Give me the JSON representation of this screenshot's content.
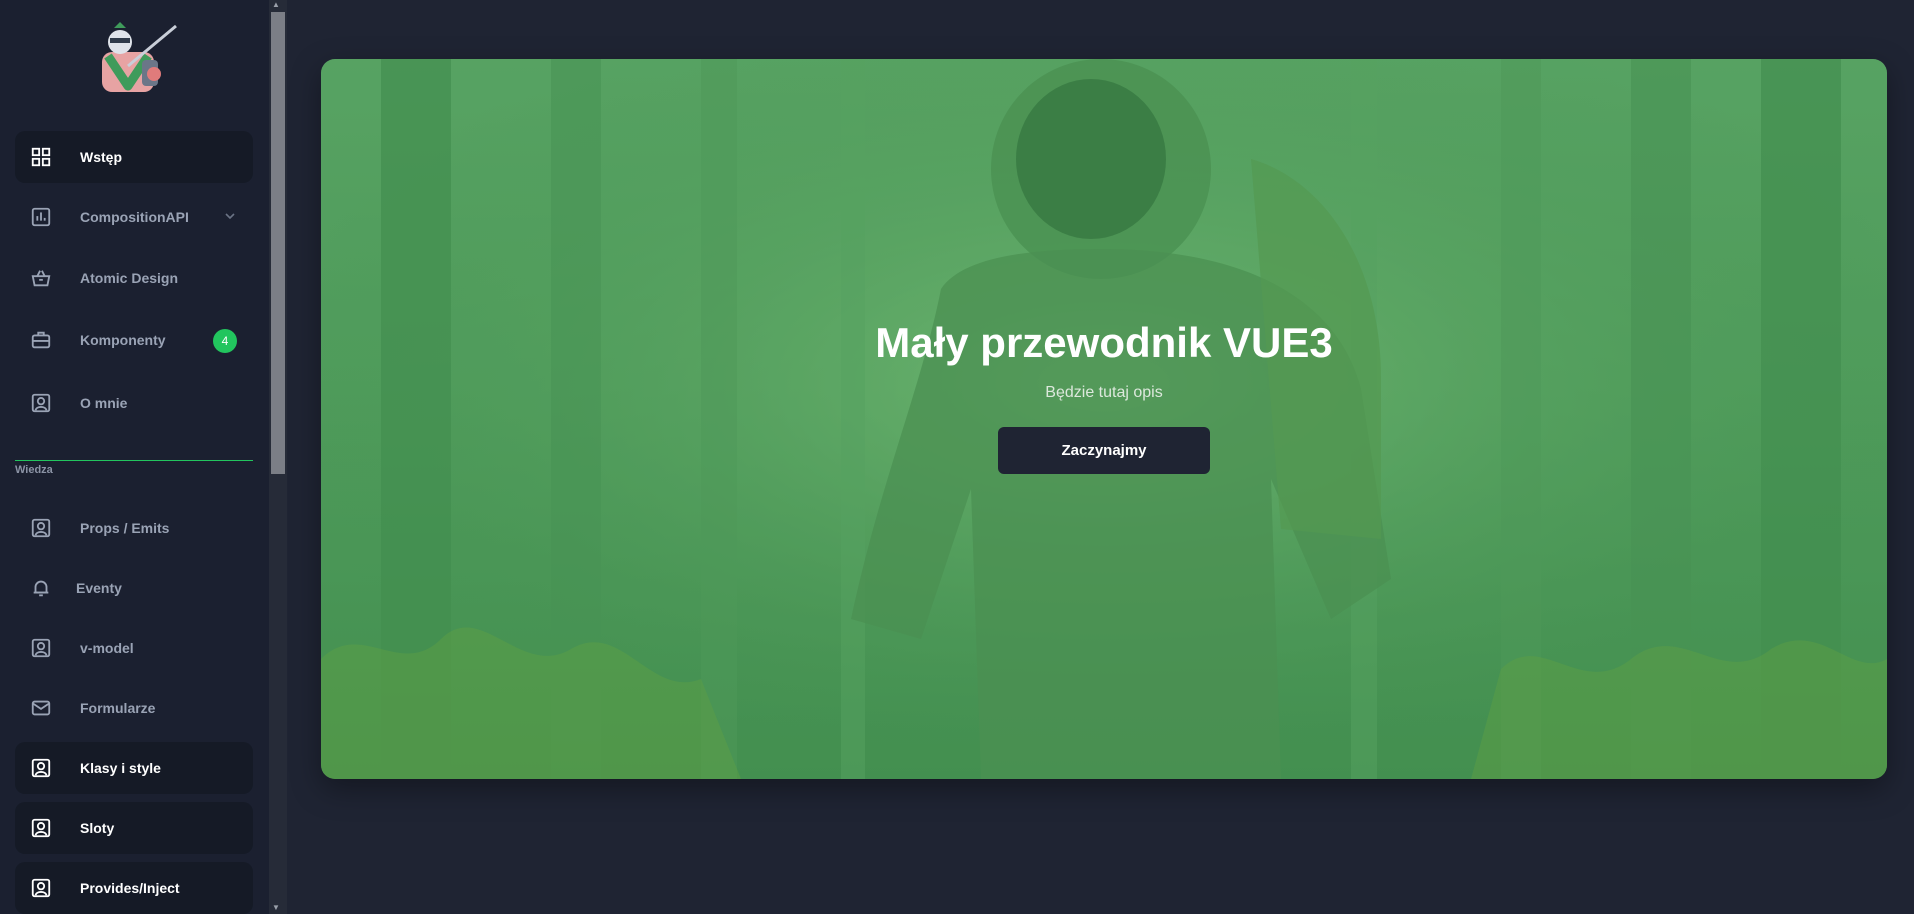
{
  "sidebar": {
    "logo_icon": "knight-vue-logo",
    "items": [
      {
        "label": "Wstęp",
        "icon": "grid-icon",
        "active": true
      },
      {
        "label": "CompositionAPI",
        "icon": "bar-chart-icon",
        "expandable": true
      },
      {
        "label": "Atomic Design",
        "icon": "basket-icon"
      },
      {
        "label": "Komponenty",
        "icon": "briefcase-icon",
        "badge": "4"
      },
      {
        "label": "O mnie",
        "icon": "user-square-icon"
      }
    ],
    "section_label": "Wiedza",
    "knowledge_items": [
      {
        "label": "Props / Emits",
        "icon": "user-square-icon"
      },
      {
        "label": "Eventy",
        "icon": "bell-icon"
      },
      {
        "label": "v-model",
        "icon": "user-square-icon"
      },
      {
        "label": "Formularze",
        "icon": "mail-icon"
      },
      {
        "label": "Klasy i style",
        "icon": "user-square-icon",
        "active": true
      },
      {
        "label": "Sloty",
        "icon": "user-square-icon",
        "active": true
      },
      {
        "label": "Provides/Inject",
        "icon": "user-square-icon",
        "active": true
      }
    ]
  },
  "hero": {
    "title": "Mały przewodnik VUE3",
    "subtitle": "Będzie tutaj opis",
    "button_label": "Zaczynajmy"
  },
  "colors": {
    "background": "#1f2433",
    "sidebar": "#1b2030",
    "accent": "#22c55e",
    "hero_green": "#4f9c5b"
  }
}
